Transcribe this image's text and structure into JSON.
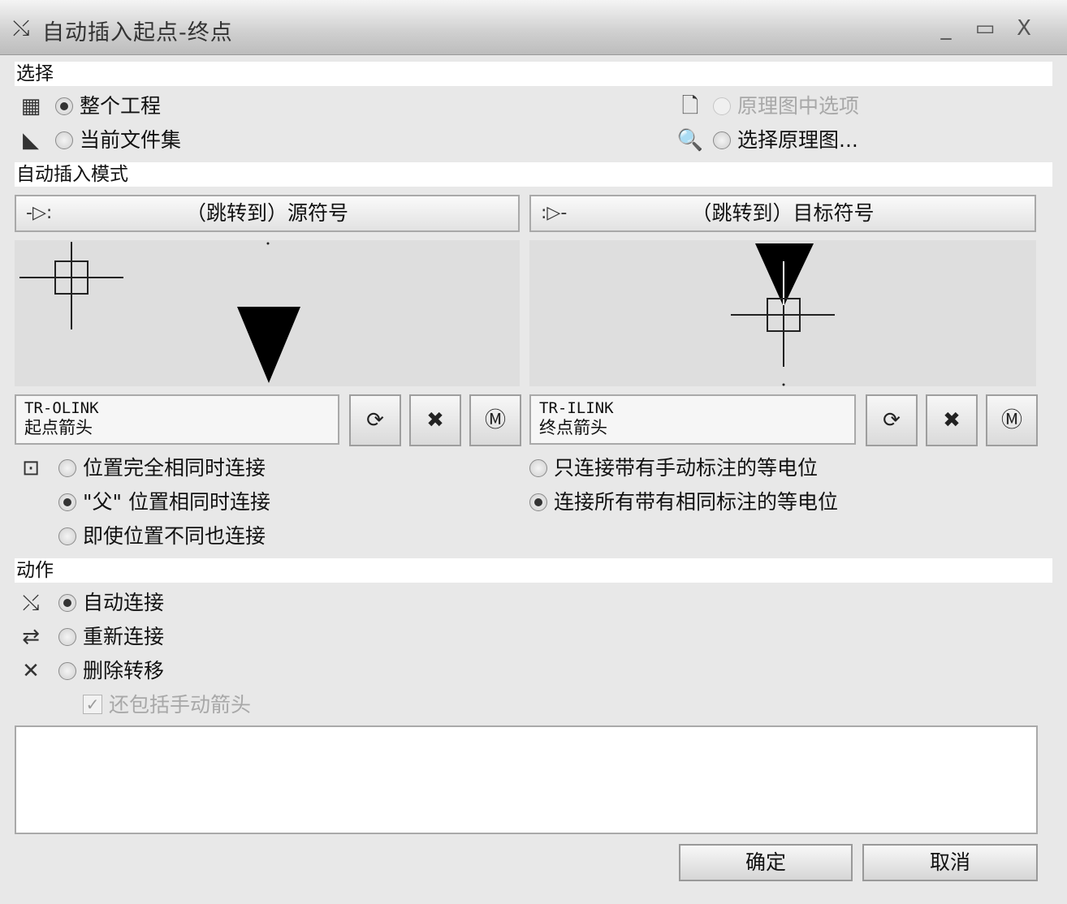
{
  "window": {
    "title": "自动插入起点-终点",
    "minimize_glyph": "_",
    "maximize_glyph": "▭",
    "close_glyph": "X"
  },
  "selection": {
    "header": "选择",
    "whole_project": "整个工程",
    "current_fileset": "当前文件集",
    "schematic_option": "原理图中选项",
    "choose_schematic": "选择原理图..."
  },
  "mode": {
    "header": "自动插入模式",
    "source_jump": "（跳转到）源符号",
    "target_jump": "（跳转到）目标符号",
    "source_symbol": {
      "code": "TR-OLINK",
      "name": "起点箭头"
    },
    "target_symbol": {
      "code": "TR-ILINK",
      "name": "终点箭头"
    },
    "conn_exact": "位置完全相同时连接",
    "conn_parent": "\"父\" 位置相同时连接",
    "conn_any": "即使位置不同也连接",
    "net_manual": "只连接带有手动标注的等电位",
    "net_all": "连接所有带有相同标注的等电位"
  },
  "action": {
    "header": "动作",
    "auto_connect": "自动连接",
    "reconnect": "重新连接",
    "delete_transfer": "删除转移",
    "include_manual": "还包括手动箭头"
  },
  "buttons": {
    "ok": "确定",
    "cancel": "取消"
  },
  "icons": {
    "title": "auto-connect-icon",
    "project": "project-icon",
    "fileset": "fileset-icon",
    "page": "page-icon",
    "search": "search-icon",
    "location": "location-icon",
    "reconnect": "reconnect-icon",
    "delete": "x-icon"
  },
  "colors": {
    "window_bg": "#e8e8e8",
    "section_bg": "#ffffff",
    "symbol_fill": "#000000"
  }
}
